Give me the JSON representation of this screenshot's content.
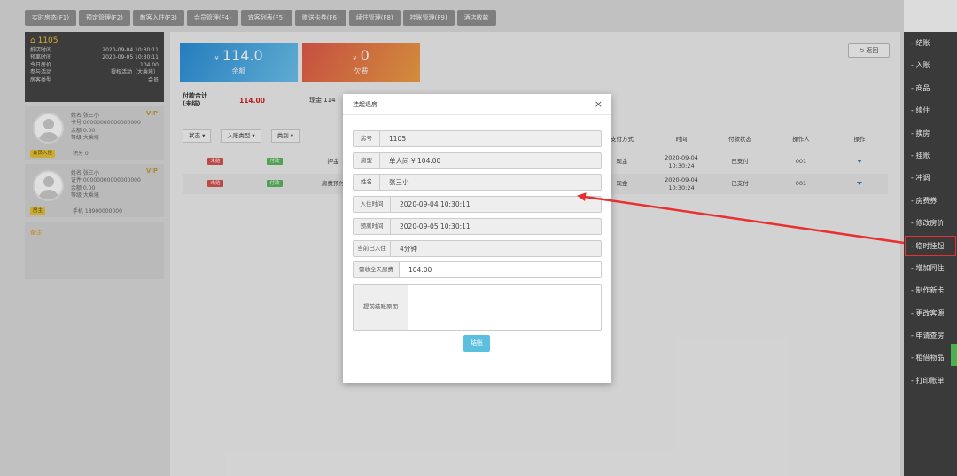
{
  "tabs": [
    "实时房态(F1)",
    "预定管理(F2)",
    "散客入住(F3)",
    "会员管理(F4)",
    "宾客列表(F5)",
    "赠送卡券(F6)",
    "续住管理(F8)",
    "挂账管理(F9)",
    "酒店收款"
  ],
  "room": {
    "number": "1105",
    "rows": [
      {
        "label": "抵店时间",
        "value": "2020-09-04 10:30:11"
      },
      {
        "label": "预离时间",
        "value": "2020-09-05 10:30:11"
      },
      {
        "label": "今日房价",
        "value": "104.00"
      },
      {
        "label": "参与活动",
        "value": "授权活动（大乘境）"
      },
      {
        "label": "房客类型",
        "value": "会员"
      }
    ]
  },
  "guests": [
    {
      "vip": "VIP",
      "lines": [
        "姓名  张三小",
        "卡号  00000000000000000",
        "余额  0.00",
        "等级  大乘境"
      ],
      "tag": "会员入住",
      "extra": "积分  0"
    },
    {
      "vip": "VIP",
      "lines": [
        "姓名  张三小",
        "证件  00000000000000000",
        "余额  0.00",
        "等级  大乘境"
      ],
      "tag": "房主",
      "extra": "手机  18900000000"
    }
  ],
  "note_label": "备注:",
  "balance": {
    "symbol": "¥",
    "amount": "114.0",
    "label": "余额"
  },
  "arrears": {
    "symbol": "¥",
    "amount": "0",
    "label": "欠费"
  },
  "back_label": "返回",
  "pay_summary": {
    "label_line1": "付款合计",
    "label_line2": "(未结)",
    "amount": "114.00",
    "cash": "现金  114"
  },
  "filters": [
    "状态",
    "入账类型",
    "类别"
  ],
  "table": {
    "headers": [
      "支付方式",
      "时间",
      "付款状态",
      "操作人",
      "操作"
    ],
    "rows": [
      {
        "status": "未结",
        "type": "付款",
        "category": "押金",
        "pay": "现金",
        "time1": "2020-09-04",
        "time2": "10:30:24",
        "state": "已支付",
        "op": "001"
      },
      {
        "status": "未结",
        "type": "付款",
        "category": "房费预付",
        "pay": "现金",
        "time1": "2020-09-04",
        "time2": "10:30:24",
        "state": "已支付",
        "op": "001"
      }
    ]
  },
  "sidebar": [
    "结账",
    "入账",
    "商品",
    "续住",
    "换房",
    "挂账",
    "冲调",
    "房费券",
    "修改房价",
    "临时挂起",
    "增加同住",
    "制作新卡",
    "更改客源",
    "申请查房",
    "租借物品",
    "打印账单"
  ],
  "modal": {
    "title": "挂起退房",
    "close": "×",
    "fields": [
      {
        "label": "房号",
        "value": "1105"
      },
      {
        "label": "房型",
        "value": "单人间 ¥ 104.00"
      },
      {
        "label": "姓名",
        "value": "张三小"
      },
      {
        "label": "入住时间",
        "value": "2020-09-04 10:30:11"
      },
      {
        "label": "预离时间",
        "value": "2020-09-05 10:30:11"
      },
      {
        "label": "当前已入住",
        "value": "4分钟"
      },
      {
        "label": "需收全天房费",
        "value": "104.00"
      }
    ],
    "reason_label": "提前结账原因",
    "reason_value": "",
    "confirm": "结账"
  },
  "colors": {
    "accent_blue": "#5bc0de",
    "highlight": "#e83030",
    "arrow": "#e83030"
  }
}
